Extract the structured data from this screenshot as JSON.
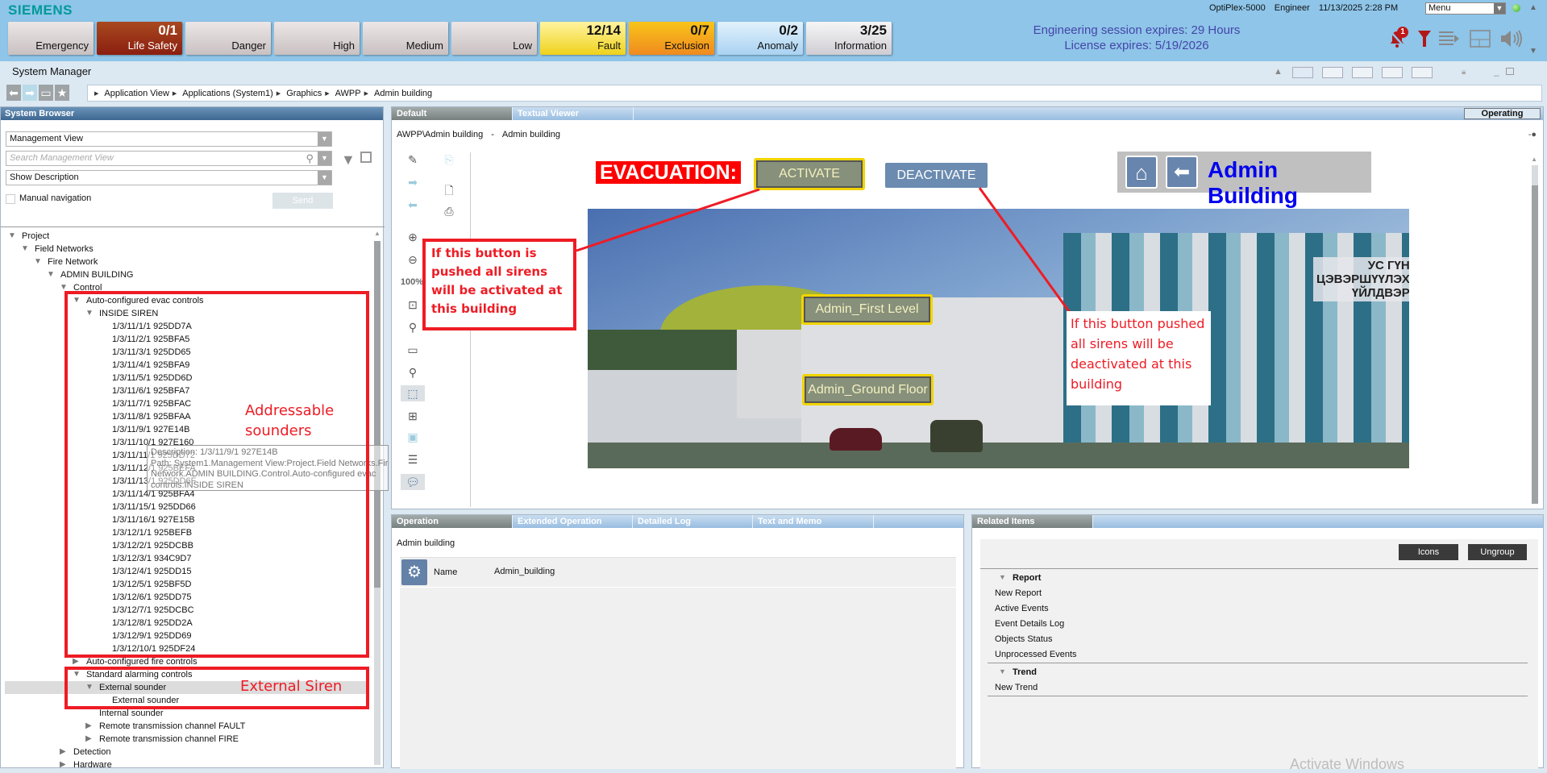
{
  "header": {
    "logo": "SIEMENS",
    "status_buttons": [
      {
        "count": "",
        "label": "Emergency",
        "style": ""
      },
      {
        "count": "0/1",
        "label": "Life Safety",
        "style": "life"
      },
      {
        "count": "",
        "label": "Danger",
        "style": ""
      },
      {
        "count": "",
        "label": "High",
        "style": ""
      },
      {
        "count": "",
        "label": "Medium",
        "style": ""
      },
      {
        "count": "",
        "label": "Low",
        "style": ""
      },
      {
        "count": "12/14",
        "label": "Fault",
        "style": "fault"
      },
      {
        "count": "0/7",
        "label": "Exclusion",
        "style": "excl"
      },
      {
        "count": "0/2",
        "label": "Anomaly",
        "style": "anom"
      },
      {
        "count": "3/25",
        "label": "Information",
        "style": "info"
      }
    ],
    "session_line1": "Engineering session expires: 29 Hours",
    "session_line2": "License expires: 5/19/2026",
    "machine": "OptiPlex-5000",
    "user": "Engineer",
    "datetime": "11/13/2025 2:28 PM",
    "menu_value": "Menu",
    "alarm_badge": "1",
    "icons": [
      "bell-muted-icon",
      "filter-icon",
      "event-list-icon",
      "layout-icon",
      "speaker-icon"
    ]
  },
  "app": {
    "title": "System Manager",
    "breadcrumb": [
      "Application View",
      "Applications (System1)",
      "Graphics",
      "AWPP",
      "Admin building"
    ]
  },
  "browser": {
    "title": "System Browser",
    "view_select": "Management View",
    "search_placeholder": "Search Management View",
    "description_select": "Show Description",
    "manual_navigation": "Manual navigation",
    "send": "Send",
    "tree": [
      {
        "label": "Project",
        "depth": 0,
        "arrow": "down"
      },
      {
        "label": "Field Networks",
        "depth": 1,
        "arrow": "down"
      },
      {
        "label": "Fire Network",
        "depth": 2,
        "arrow": "down"
      },
      {
        "label": "ADMIN BUILDING",
        "depth": 3,
        "arrow": "down"
      },
      {
        "label": "Control",
        "depth": 4,
        "arrow": "down"
      },
      {
        "label": "Auto-configured evac controls",
        "depth": 5,
        "arrow": "down"
      },
      {
        "label": "INSIDE SIREN",
        "depth": 6,
        "arrow": "down"
      },
      {
        "label": "1/3/11/1/1 925DD7A",
        "depth": 7
      },
      {
        "label": "1/3/11/2/1 925BFA5",
        "depth": 7
      },
      {
        "label": "1/3/11/3/1 925DD65",
        "depth": 7
      },
      {
        "label": "1/3/11/4/1 925BFA9",
        "depth": 7
      },
      {
        "label": "1/3/11/5/1 925DD6D",
        "depth": 7
      },
      {
        "label": "1/3/11/6/1 925BFA7",
        "depth": 7
      },
      {
        "label": "1/3/11/7/1 925BFAC",
        "depth": 7
      },
      {
        "label": "1/3/11/8/1 925BFAA",
        "depth": 7
      },
      {
        "label": "1/3/11/9/1 927E14B",
        "depth": 7
      },
      {
        "label": "1/3/11/10/1 927E160",
        "depth": 7
      },
      {
        "label": "1/3/11/11/1 925DD72",
        "depth": 7
      },
      {
        "label": "1/3/11/12/1 925BEFA",
        "depth": 7
      },
      {
        "label": "1/3/11/13/1 925DD6F",
        "depth": 7
      },
      {
        "label": "1/3/11/14/1 925BFA4",
        "depth": 7
      },
      {
        "label": "1/3/11/15/1 925DD66",
        "depth": 7
      },
      {
        "label": "1/3/11/16/1 927E15B",
        "depth": 7
      },
      {
        "label": "1/3/12/1/1 925BEFB",
        "depth": 7
      },
      {
        "label": "1/3/12/2/1 925DCBB",
        "depth": 7
      },
      {
        "label": "1/3/12/3/1 934C9D7",
        "depth": 7
      },
      {
        "label": "1/3/12/4/1 925DD15",
        "depth": 7
      },
      {
        "label": "1/3/12/5/1 925BF5D",
        "depth": 7
      },
      {
        "label": "1/3/12/6/1 925DD75",
        "depth": 7
      },
      {
        "label": "1/3/12/7/1 925DCBC",
        "depth": 7
      },
      {
        "label": "1/3/12/8/1 925DD2A",
        "depth": 7
      },
      {
        "label": "1/3/12/9/1 925DD69",
        "depth": 7
      },
      {
        "label": "1/3/12/10/1 925DF24",
        "depth": 7
      },
      {
        "label": "Auto-configured fire controls",
        "depth": 5,
        "arrow": "right"
      },
      {
        "label": "Standard alarming controls",
        "depth": 5,
        "arrow": "down"
      },
      {
        "label": "External sounder",
        "depth": 6,
        "arrow": "down",
        "selected": true
      },
      {
        "label": "External sounder",
        "depth": 7
      },
      {
        "label": "Internal sounder",
        "depth": 6
      },
      {
        "label": "Remote transmission channel FAULT",
        "depth": 6,
        "arrow": "right"
      },
      {
        "label": "Remote transmission channel FIRE",
        "depth": 6,
        "arrow": "right"
      },
      {
        "label": "Detection",
        "depth": 4,
        "arrow": "right"
      },
      {
        "label": "Hardware",
        "depth": 4,
        "arrow": "right"
      }
    ],
    "tooltip": [
      "Description: 1/3/11/9/1 927E14B",
      "Path: System1.Management View:Project.Field Networks.Fire",
      "Network.ADMIN BUILDING.Control.Auto-configured evac",
      "controls.INSIDE SIREN"
    ]
  },
  "annotations": {
    "addressable_1": "Addressable",
    "addressable_2": "sounders",
    "external_siren": "External Siren",
    "activate_note": "If this button is pushed all sirens will be activated at this building",
    "deactivate_note": "If this button pushed all sirens will be deactivated at this building",
    "color": "#ee1c25"
  },
  "graphics": {
    "tabs": [
      "Default",
      "Textual Viewer"
    ],
    "mode": "Operating",
    "path": "AWPP\\Admin building",
    "path_desc": "Admin building",
    "zoom_level": "100%",
    "evacuation_label": "EVACUATION:",
    "activate": "ACTIVATE",
    "deactivate": "DEACTIVATE",
    "title": "Admin Building",
    "first_level": "Admin_First Level",
    "ground_floor": "Admin_Ground Floor",
    "sign_lines": [
      "УС ГҮН",
      "ЦЭВЭРШҮҮЛЭХ",
      "ҮЙЛДВЭР"
    ]
  },
  "operation": {
    "tabs": [
      "Operation",
      "Extended Operation",
      "Detailed Log",
      "Text and Memo"
    ],
    "object": "Admin building",
    "name_label": "Name",
    "name_value": "Admin_building"
  },
  "related": {
    "title": "Related Items",
    "icons_btn": "Icons",
    "ungroup_btn": "Ungroup",
    "groups": [
      {
        "title": "Report",
        "items": [
          "New Report",
          "Active Events",
          "Event Details Log",
          "Objects Status",
          "Unprocessed Events"
        ]
      },
      {
        "title": "Trend",
        "items": [
          "New Trend"
        ]
      }
    ]
  },
  "watermark": "Activate Windows"
}
